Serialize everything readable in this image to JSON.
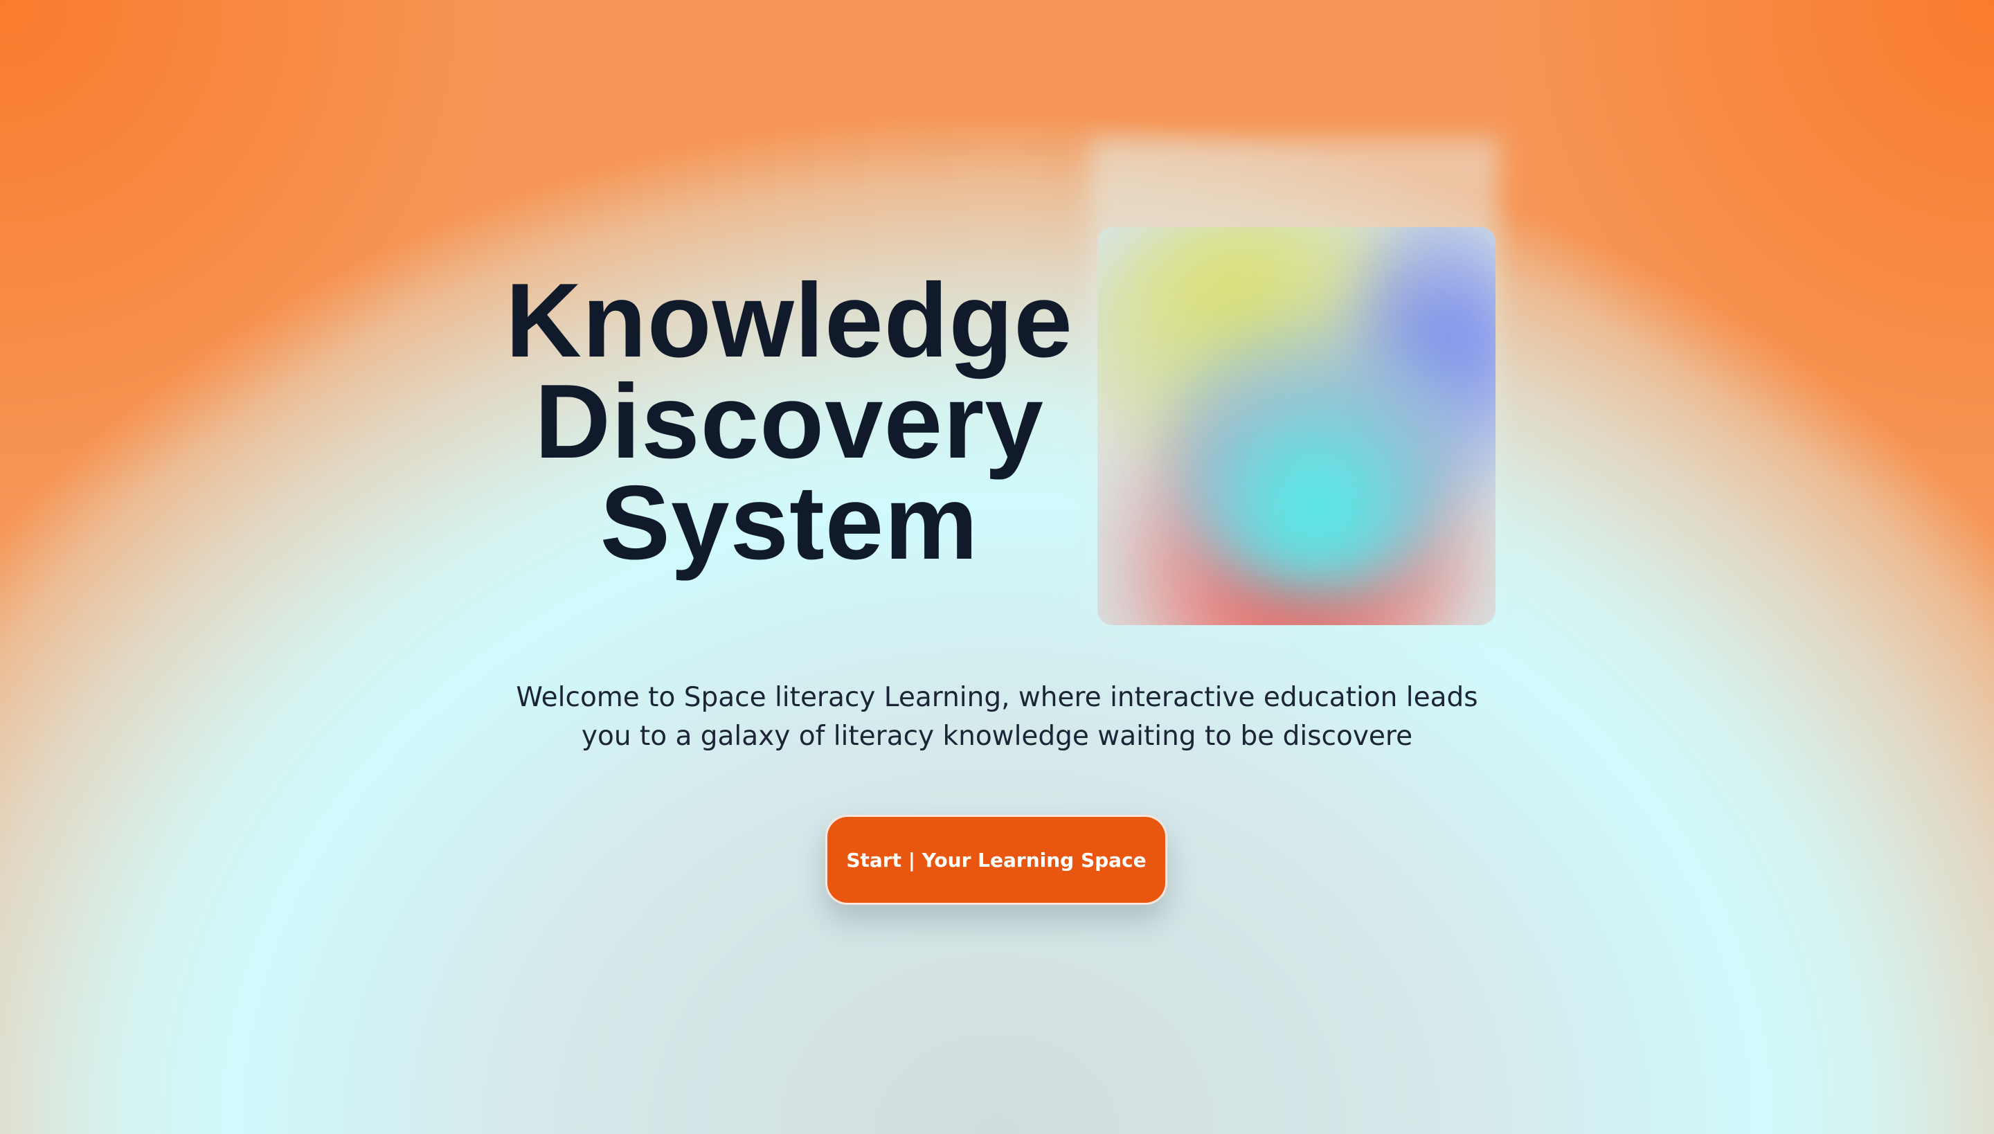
{
  "hero": {
    "title_lines": [
      "Knowledge",
      "Discovery",
      "System"
    ],
    "intro": "Welcome to Space literacy Learning, where interactive education leads you to a galaxy of literacy knowledge waiting to be discovere"
  },
  "cta": {
    "label": "Start | Your Learning Space"
  },
  "colors": {
    "title": "#101a2b",
    "cta_background": "#e8560f",
    "background_edge": "#f47b2c",
    "background_center": "#d0fafc"
  },
  "decoration": {
    "orb_image": "abstract-gradient-orb"
  }
}
